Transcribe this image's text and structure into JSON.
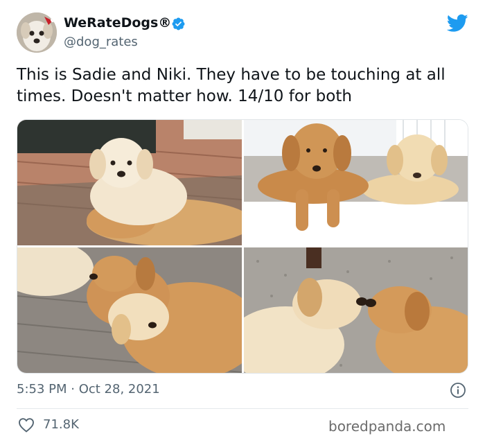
{
  "user": {
    "display_name": "WeRateDogs®",
    "handle": "@dog_rates",
    "verified": true,
    "avatar_icon": "dog-avatar-icon"
  },
  "tweet": {
    "text": "This is Sadie and Niki. They have to be touching at all times. Doesn't matter how. 14/10 for both",
    "timestamp": "5:53 PM · Oct 28, 2021",
    "like_count": "71.8K"
  },
  "media": {
    "photo_count": 4,
    "photos": [
      "two-puppies-on-deck-photo",
      "two-puppies-on-step-photo",
      "puppies-sleeping-photo",
      "puppies-nose-to-nose-photo"
    ]
  },
  "icons": {
    "brand": "twitter-bird-icon",
    "verified": "verified-badge-icon",
    "info": "info-icon",
    "like": "heart-icon"
  },
  "watermark": "boredpanda.com",
  "colors": {
    "twitter_blue": "#1d9bf0",
    "text_primary": "#0f1419",
    "text_secondary": "#536471",
    "divider": "#e4e8eb"
  }
}
